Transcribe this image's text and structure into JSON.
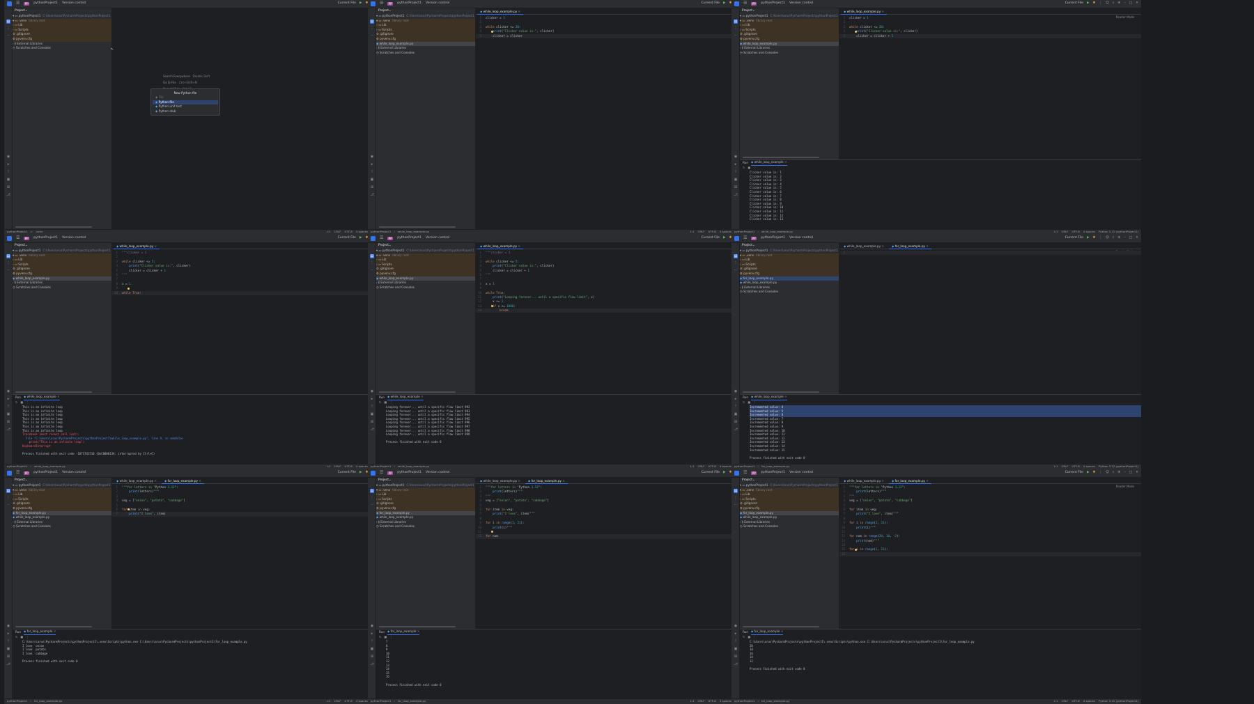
{
  "common": {
    "project_name": "pythonProject1",
    "project_badge": "PP",
    "vcs": "Version control",
    "run_config": "Current File",
    "project_label": "Project",
    "run_label": "Run",
    "reader_mode": "Reader Mode",
    "tree": {
      "root": "pythonProject1",
      "root_path": "C:\\Users\\arus\\PycharmProjects\\pythonProject1",
      "venv": ".venv",
      "venv_note": "library root",
      "lib": "Lib",
      "scripts": "Scripts",
      "gitignore": ".gitignore",
      "pyvenv": "pyvenv.cfg",
      "while_file": "while_loop_example.py",
      "for_file": "for_loop_example.py",
      "ext_libs": "External Libraries",
      "scratches": "Scratches and Consoles"
    },
    "status_right": [
      "1:1",
      "CRLF",
      "UTF-8",
      "4 spaces",
      "Python 3.12 (pythonProject1)"
    ],
    "status_path_venv": [
      "pythonProject1",
      ">",
      ".venv"
    ]
  },
  "panes": [
    {
      "title": "pane-1-new-file",
      "search_everywhere": "Search Everywhere",
      "search_shortcut": "Double Shift",
      "goto_file": "Go to File",
      "goto_shortcut": "Ctrl+Shift+N",
      "recent_files": "Recent Files",
      "recent_shortcut": "Ctrl+E",
      "new_file_title": "New Python file",
      "new_file_items": [
        "Python file",
        "Python unit test",
        "Python stub"
      ],
      "new_file_input": "File"
    },
    {
      "title": "pane-2-while-edit",
      "tab": "while_loop_example.py",
      "code": [
        {
          "n": "1",
          "t": "clicker = 1"
        },
        {
          "n": "2",
          "t": ""
        },
        {
          "n": "3",
          "t": "while clicker <= 20:"
        },
        {
          "n": "4",
          "t": "    print(\"Clicker value is:\", clicker)"
        },
        {
          "n": "5",
          "t": "    clicker = clicker"
        }
      ]
    },
    {
      "title": "pane-3-while-run",
      "tab": "while_loop_example.py",
      "code": [
        {
          "n": "1",
          "t": "clicker = 1"
        },
        {
          "n": "2",
          "t": ""
        },
        {
          "n": "3",
          "t": "while clicker <= 20:"
        },
        {
          "n": "4",
          "t": "    print(\"Clicker value is:\", clicker)"
        },
        {
          "n": "5",
          "t": "    clicker = clicker + 1"
        }
      ],
      "run_tab": "while_loop_example",
      "output": [
        "Clicker value is: 1",
        "Clicker value is: 2",
        "Clicker value is: 3",
        "Clicker value is: 4",
        "Clicker value is: 5",
        "Clicker value is: 6",
        "Clicker value is: 7",
        "Clicker value is: 8",
        "Clicker value is: 9",
        "Clicker value is: 10",
        "Clicker value is: 11",
        "Clicker value is: 12",
        "Clicker value is: 13"
      ]
    },
    {
      "title": "pane-4-infinite",
      "tab": "while_loop_example.py",
      "code": [
        {
          "n": "1",
          "t": "\"\"\"clicker = 1"
        },
        {
          "n": "2",
          "t": ""
        },
        {
          "n": "3",
          "t": "while clicker <= 5:"
        },
        {
          "n": "4",
          "t": "    print(\"Clicker value is:\", clicker)"
        },
        {
          "n": "5",
          "t": "    clicker = clicker + 1"
        },
        {
          "n": "6",
          "t": "\"\"\""
        },
        {
          "n": "7",
          "t": ""
        },
        {
          "n": "8",
          "t": "x = 1"
        },
        {
          "n": "9",
          "t": ""
        },
        {
          "n": "10",
          "t": "while True:"
        }
      ],
      "run_tab": "while_loop_example",
      "output": [
        "This is an infinite loop",
        "This is an infinite loop",
        "This is an infinite loop",
        "This is an infinite loop",
        "This is an infinite loop",
        "This is an infinite loop",
        "This is an infinite loop",
        "Traceback (most recent call last):",
        "  File \"C:\\Users\\arus\\PycharmProjects\\pythonProject1\\while_loop_example.py\", line 9, in <module>",
        "    print(\"This is an infinite loop\")",
        "KeyboardInterrupt",
        "",
        "Process finished with exit code -1073741510 (0xC000013A: interrupted by Ctrl+C)"
      ]
    },
    {
      "title": "pane-5-break",
      "tab": "while_loop_example.py",
      "code": [
        {
          "n": "1",
          "t": "\"\"\"clicker = 1"
        },
        {
          "n": "2",
          "t": ""
        },
        {
          "n": "3",
          "t": "while clicker <= 5:"
        },
        {
          "n": "4",
          "t": "    print(\"Clicker value is:\", clicker)"
        },
        {
          "n": "5",
          "t": "    clicker = clicker + 1"
        },
        {
          "n": "6",
          "t": "\"\"\""
        },
        {
          "n": "7",
          "t": ""
        },
        {
          "n": "8",
          "t": "x = 1"
        },
        {
          "n": "9",
          "t": ""
        },
        {
          "n": "10",
          "t": "while True:"
        },
        {
          "n": "11",
          "t": "    print(\"Looping forever... until a specific flow limit\", x)"
        },
        {
          "n": "12",
          "t": "    x += 1"
        },
        {
          "n": "13",
          "t": "    if x >= 1000:"
        },
        {
          "n": "14",
          "t": "        break"
        }
      ],
      "run_tab": "while_loop_example",
      "output": [
        "Looping forever... until a specific flow limit 992",
        "Looping forever... until a specific flow limit 993",
        "Looping forever... until a specific flow limit 994",
        "Looping forever... until a specific flow limit 995",
        "Looping forever... until a specific flow limit 996",
        "Looping forever... until a specific flow limit 997",
        "Looping forever... until a specific flow limit 998",
        "Looping forever... until a specific flow limit 999",
        "",
        "Process finished with exit code 0"
      ]
    },
    {
      "title": "pane-6-for-new",
      "tabs": [
        "while_loop_example.py",
        "for_loop_example.py"
      ],
      "code": [
        {
          "n": "1",
          "t": ""
        }
      ],
      "run_tab": "while_loop_example",
      "output": [
        "Incremented value: 4",
        "Incremented value: 5",
        "Incremented value: 6",
        "Incremented value: 7",
        "Incremented value: 8",
        "Incremented value: 9",
        "Incremented value: 10",
        "Incremented value: 11",
        "Incremented value: 12",
        "Incremented value: 13",
        "Incremented value: 14",
        "Incremented value: 15",
        "",
        "Process finished with exit code 0"
      ]
    },
    {
      "title": "pane-7-for-list",
      "tabs": [
        "while_loop_example.py",
        "for_loop_example.py"
      ],
      "code": [
        {
          "n": "1",
          "t": "\"\"\"for letters in \"Python 3.12\":"
        },
        {
          "n": "2",
          "t": "    print(letters)\"\"\""
        },
        {
          "n": "3",
          "t": ""
        },
        {
          "n": "4",
          "t": "veg = [\"onion\", \"potato\", \"cabbage\"]"
        },
        {
          "n": "5",
          "t": ""
        },
        {
          "n": "6",
          "t": "for item in veg:"
        },
        {
          "n": "7",
          "t": "    print(\"I love\", item)"
        }
      ],
      "run_tab": "for_loop_example",
      "output": [
        "C:\\Users\\arus\\PycharmProjects\\pythonProject1\\.venv\\Scripts\\python.exe C:\\Users\\arus\\PycharmProjects\\pythonProject1\\for_loop_example.py",
        "I love  onion",
        "I love  potato",
        "I love  cabbage",
        "",
        "Process finished with exit code 0"
      ]
    },
    {
      "title": "pane-8-for-range",
      "tabs": [
        "while_loop_example.py",
        "for_loop_example.py"
      ],
      "code": [
        {
          "n": "1",
          "t": "\"\"\"for letters in \"Python 3.12\":"
        },
        {
          "n": "2",
          "t": "    print(letters)\"\"\""
        },
        {
          "n": "3",
          "t": "\"\"\""
        },
        {
          "n": "4",
          "t": "veg = [\"onion\", \"potato\", \"cabbage\"]"
        },
        {
          "n": "5",
          "t": ""
        },
        {
          "n": "6",
          "t": "for item in veg:"
        },
        {
          "n": "7",
          "t": "    print(\"I love\", item)\"\"\""
        },
        {
          "n": "8",
          "t": ""
        },
        {
          "n": "9",
          "t": "for i in range(1, 21):"
        },
        {
          "n": "10",
          "t": "    print(i)\"\"\""
        },
        {
          "n": "11",
          "t": ""
        },
        {
          "n": "12",
          "t": "for num"
        }
      ],
      "run_tab": "for_loop_example",
      "output": [
        "7",
        "8",
        "9",
        "10",
        "11",
        "12",
        "13",
        "14",
        "15",
        "16",
        "",
        "Process finished with exit code 0"
      ]
    },
    {
      "title": "pane-9-for-step",
      "tabs": [
        "while_loop_example.py",
        "for_loop_example.py"
      ],
      "code": [
        {
          "n": "1",
          "t": "\"\"\"for letters in \"Python 3.12\":"
        },
        {
          "n": "2",
          "t": "    print(letters)\"\"\""
        },
        {
          "n": "3",
          "t": "\"\"\""
        },
        {
          "n": "4",
          "t": "veg = [\"onion\", \"potato\", \"cabbage\"]"
        },
        {
          "n": "5",
          "t": ""
        },
        {
          "n": "6",
          "t": "for item in veg:"
        },
        {
          "n": "7",
          "t": "    print(\"I love\", item)\"\"\""
        },
        {
          "n": "8",
          "t": ""
        },
        {
          "n": "9",
          "t": "for i in range(1, 21):"
        },
        {
          "n": "10",
          "t": "    print(i)\"\"\""
        },
        {
          "n": "11",
          "t": ""
        },
        {
          "n": "12",
          "t": "for num in range(20, 10, -2):"
        },
        {
          "n": "13",
          "t": "    print(num)\"\"\""
        },
        {
          "n": "14",
          "t": ""
        },
        {
          "n": "15",
          "t": "for i in range(1, 21):"
        },
        {
          "n": "16",
          "t": "    "
        }
      ],
      "run_tab": "for_loop_example",
      "output": [
        "C:\\Users\\arus\\PycharmProjects\\pythonProject1\\.venv\\Scripts\\python.exe C:\\Users\\arus\\PycharmProjects\\pythonProject1\\for_loop_example.py",
        "20",
        "18",
        "16",
        "14",
        "12",
        "",
        "Process finished with exit code 0"
      ]
    }
  ]
}
